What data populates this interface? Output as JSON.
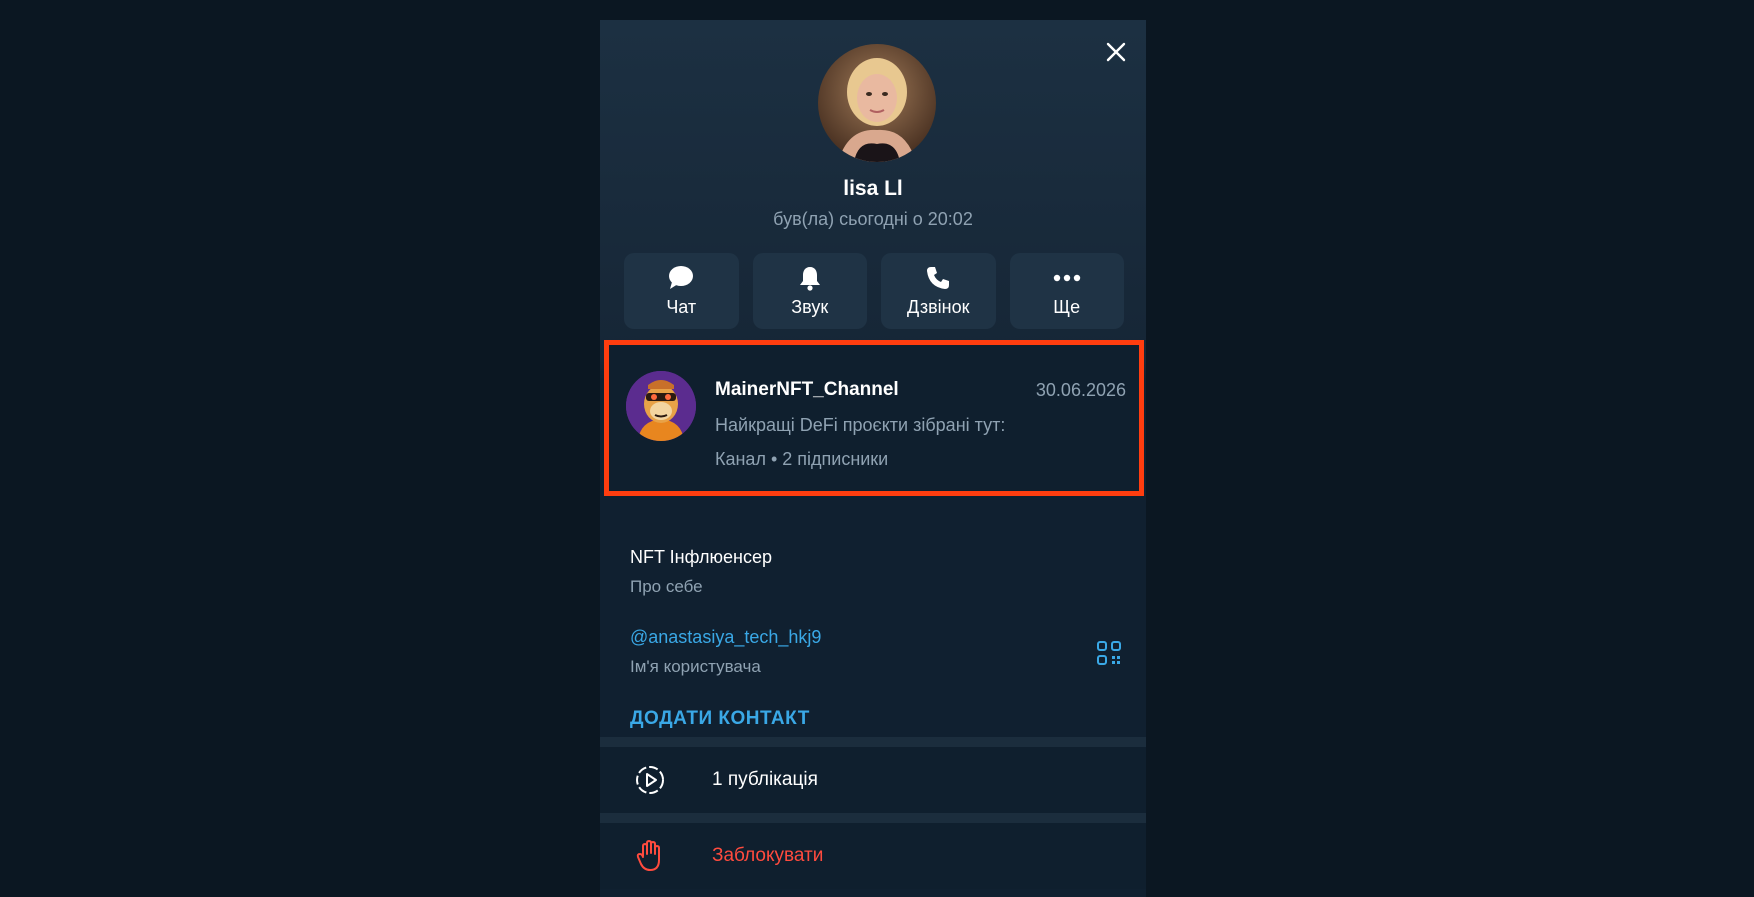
{
  "profile": {
    "name": "lisa Ll",
    "status": "був(ла) сьогодні о 20:02"
  },
  "actions": [
    {
      "label": "Чат",
      "icon": "chat-bubble-icon"
    },
    {
      "label": "Звук",
      "icon": "bell-icon"
    },
    {
      "label": "Дзвінок",
      "icon": "phone-icon"
    },
    {
      "label": "Ще",
      "icon": "more-dots-icon"
    }
  ],
  "channel": {
    "name": "MainerNFT_Channel",
    "date": "30.06.2026",
    "description": "Найкращі DeFi проєкти зібрані тут:",
    "meta": "Канал • 2 підписники",
    "highlight_color": "#ff3d0f"
  },
  "info": {
    "bio": "NFT Інфлюенсер",
    "bio_label": "Про себе",
    "username": "@anastasiya_tech_hkj9",
    "username_label": "Ім'я користувача",
    "add_contact": "ДОДАТИ КОНТАКТ"
  },
  "rows": {
    "publications": "1 публікація",
    "block": "Заблокувати"
  },
  "colors": {
    "accent": "#3aa8e6",
    "danger": "#ff4b3e",
    "background": "#0b1722"
  }
}
